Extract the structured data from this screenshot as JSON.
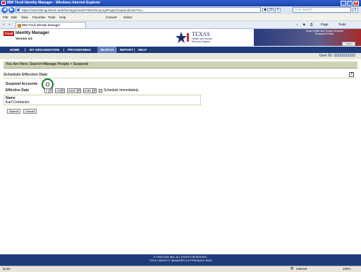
{
  "window": {
    "title": "IBM Tivoli Identity Manager - Windows Internet Explorer",
    "minimize": "_",
    "maximize": "□",
    "close": "×"
  },
  "browser": {
    "url": "https://ssd-9/itimgui/tivoli-auth/ibmlogin/tivoli/ITIM/ctrl/myorg/Rmgm/SuspendUser?src=",
    "search_placeholder": "Live Search",
    "back": "◀",
    "forward": "▶",
    "menu": [
      "File",
      "Edit",
      "View",
      "Favorites",
      "Tools",
      "Help"
    ],
    "toolbar": [
      "Convert",
      "Select"
    ],
    "tab_label": "IBM Tivoli Identity Manager",
    "tools": [
      "Page",
      "Tools"
    ]
  },
  "header": {
    "brand": "Tivoli",
    "app_title": "Identity Manager",
    "version": "Version 4.6",
    "texas_title": "TEXAS",
    "texas_sub": [
      "Health and Human",
      "Services System"
    ],
    "banner_text": [
      "Texas Health and Human Services",
      "Enterprise Portal"
    ],
    "logout": "Logout"
  },
  "nav": {
    "items": [
      "HOME",
      "MY ORGANIZATION",
      "PROVISIONING",
      "SEARCH",
      "REPORT",
      "HELP"
    ],
    "separators": [
      "|",
      "|",
      "|",
      "|",
      "|"
    ]
  },
  "user_id": "User ID: 32222222222",
  "breadcrumb": "You Are Here: Search>Manage People > Suspend",
  "form": {
    "section_title": "Schedule Effective Date",
    "help": "?",
    "suspend_label": "Suspend Accounts",
    "effective_date_label": "Effective Date",
    "month": "7",
    "day": "13",
    "year": "2010",
    "time": "5:00",
    "schedule_label": "Schedule Immediately",
    "schedule_checked": "✓",
    "name_label": "Name",
    "name_value": "Karl Contractor",
    "submit": "Submit",
    "cancel": "Cancel"
  },
  "footer": {
    "line1": "© 1999-2005 IBM. ALL RIGHTS RESERVED.",
    "line2": "TIVOLI IDENTITY MANAGER 4.6 FP38 BUILD 5026"
  },
  "status": {
    "left": "Done",
    "zone": "Internet",
    "zoom": "100%"
  }
}
